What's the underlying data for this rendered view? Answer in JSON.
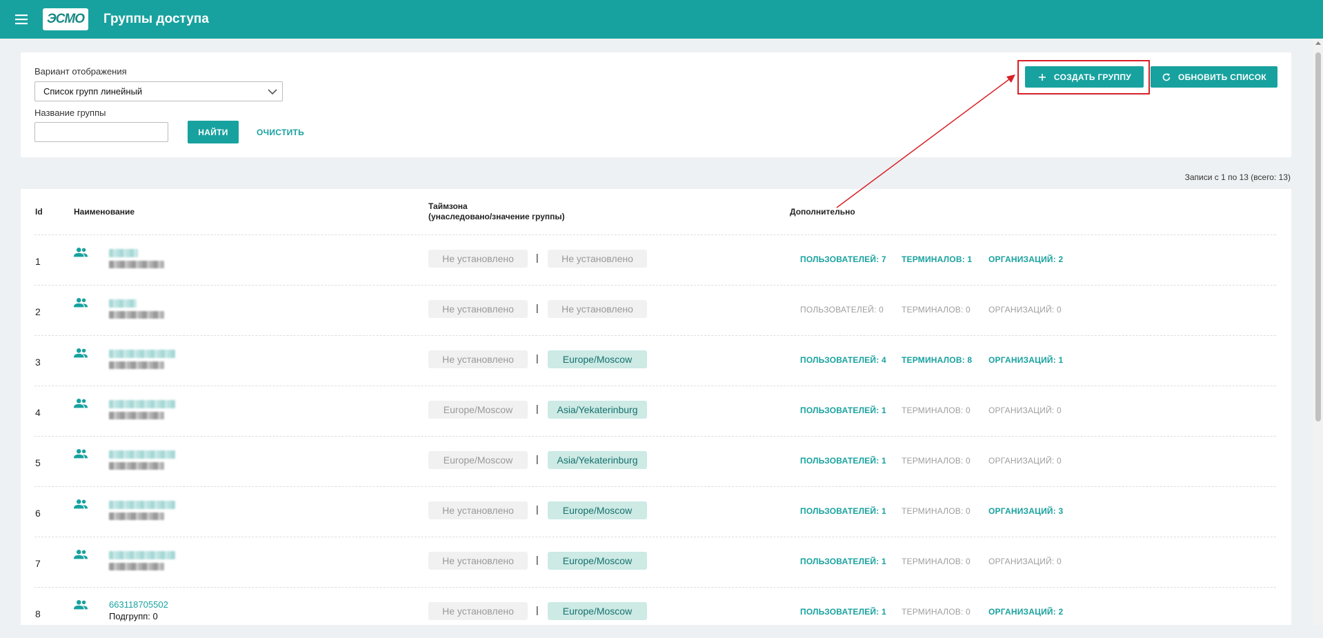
{
  "header": {
    "title": "Группы доступа",
    "logo_text": "ЭСМО"
  },
  "filters": {
    "view_label": "Вариант отображения",
    "view_value": "Список групп линейный",
    "name_label": "Название группы",
    "name_value": "",
    "find_label": "НАЙТИ",
    "clear_label": "ОЧИСТИТЬ"
  },
  "actions": {
    "create_label": "СОЗДАТЬ ГРУППУ",
    "refresh_label": "ОБНОВИТЬ СПИСОК"
  },
  "records_text": "Записи с 1 по 13 (всего: 13)",
  "columns": {
    "id": "Id",
    "name": "Наименование",
    "tz_line1": "Таймзона",
    "tz_line2": "(унаследовано/значение группы)",
    "extra": "Дополнительно"
  },
  "rows": [
    {
      "id": "1",
      "name": "",
      "subgroups": "",
      "tz_inherited": "Не установлено",
      "tz_group": "Не установлено",
      "tz_group_set": false,
      "users": "ПОЛЬЗОВАТЕЛЕЙ: 7",
      "users_active": true,
      "terminals": "ТЕРМИНАЛОВ: 1",
      "terminals_active": true,
      "orgs": "ОРГАНИЗАЦИЙ: 2",
      "orgs_active": true
    },
    {
      "id": "2",
      "name": "",
      "subgroups": "",
      "tz_inherited": "Не установлено",
      "tz_group": "Не установлено",
      "tz_group_set": false,
      "users": "ПОЛЬЗОВАТЕЛЕЙ: 0",
      "users_active": false,
      "terminals": "ТЕРМИНАЛОВ: 0",
      "terminals_active": false,
      "orgs": "ОРГАНИЗАЦИЙ: 0",
      "orgs_active": false
    },
    {
      "id": "3",
      "name": "",
      "subgroups": "",
      "tz_inherited": "Не установлено",
      "tz_group": "Europe/Moscow",
      "tz_group_set": true,
      "users": "ПОЛЬЗОВАТЕЛЕЙ: 4",
      "users_active": true,
      "terminals": "ТЕРМИНАЛОВ: 8",
      "terminals_active": true,
      "orgs": "ОРГАНИЗАЦИЙ: 1",
      "orgs_active": true
    },
    {
      "id": "4",
      "name": "",
      "subgroups": "",
      "tz_inherited": "Europe/Moscow",
      "tz_group": "Asia/Yekaterinburg",
      "tz_group_set": true,
      "users": "ПОЛЬЗОВАТЕЛЕЙ: 1",
      "users_active": true,
      "terminals": "ТЕРМИНАЛОВ: 0",
      "terminals_active": false,
      "orgs": "ОРГАНИЗАЦИЙ: 0",
      "orgs_active": false
    },
    {
      "id": "5",
      "name": "",
      "subgroups": "",
      "tz_inherited": "Europe/Moscow",
      "tz_group": "Asia/Yekaterinburg",
      "tz_group_set": true,
      "users": "ПОЛЬЗОВАТЕЛЕЙ: 1",
      "users_active": true,
      "terminals": "ТЕРМИНАЛОВ: 0",
      "terminals_active": false,
      "orgs": "ОРГАНИЗАЦИЙ: 0",
      "orgs_active": false
    },
    {
      "id": "6",
      "name": "",
      "subgroups": "",
      "tz_inherited": "Не установлено",
      "tz_group": "Europe/Moscow",
      "tz_group_set": true,
      "users": "ПОЛЬЗОВАТЕЛЕЙ: 1",
      "users_active": true,
      "terminals": "ТЕРМИНАЛОВ: 0",
      "terminals_active": false,
      "orgs": "ОРГАНИЗАЦИЙ: 3",
      "orgs_active": true
    },
    {
      "id": "7",
      "name": "",
      "subgroups": "",
      "tz_inherited": "Не установлено",
      "tz_group": "Europe/Moscow",
      "tz_group_set": true,
      "users": "ПОЛЬЗОВАТЕЛЕЙ: 1",
      "users_active": true,
      "terminals": "ТЕРМИНАЛОВ: 0",
      "terminals_active": false,
      "orgs": "ОРГАНИЗАЦИЙ: 0",
      "orgs_active": false
    },
    {
      "id": "8",
      "name": "663118705502",
      "subgroups": "Подгрупп: 0",
      "tz_inherited": "Не установлено",
      "tz_group": "Europe/Moscow",
      "tz_group_set": true,
      "users": "ПОЛЬЗОВАТЕЛЕЙ: 1",
      "users_active": true,
      "terminals": "ТЕРМИНАЛОВ: 0",
      "terminals_active": false,
      "orgs": "ОРГАНИЗАЦИЙ: 2",
      "orgs_active": true
    }
  ],
  "colors": {
    "primary": "#18a29f",
    "annotation": "#d81f26",
    "tz_set_bg": "#cdeae5"
  },
  "icons": {
    "menu": "menu-icon",
    "plus": "plus-icon",
    "refresh": "refresh-icon",
    "group": "group-icon",
    "chevron": "chevron-down-icon"
  }
}
